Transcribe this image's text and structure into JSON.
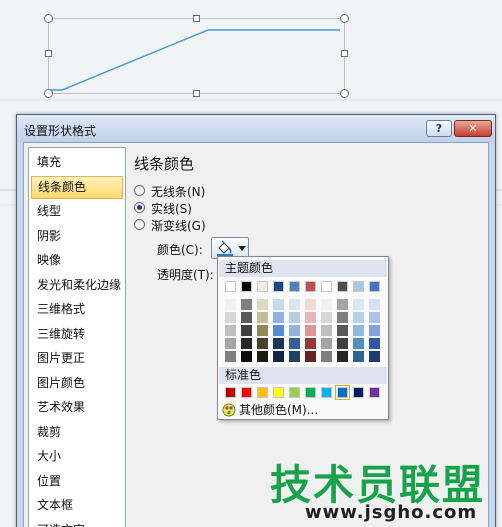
{
  "dialog": {
    "title": "设置形状格式",
    "help_label": "?",
    "close_label": "✕"
  },
  "nav": {
    "items": [
      {
        "label": "填充"
      },
      {
        "label": "线条颜色"
      },
      {
        "label": "线型"
      },
      {
        "label": "阴影"
      },
      {
        "label": "映像"
      },
      {
        "label": "发光和柔化边缘"
      },
      {
        "label": "三维格式"
      },
      {
        "label": "三维旋转"
      },
      {
        "label": "图片更正"
      },
      {
        "label": "图片颜色"
      },
      {
        "label": "艺术效果"
      },
      {
        "label": "裁剪"
      },
      {
        "label": "大小"
      },
      {
        "label": "位置"
      },
      {
        "label": "文本框"
      },
      {
        "label": "可选文字"
      }
    ],
    "selected": "线条颜色"
  },
  "panel": {
    "title": "线条颜色",
    "options": [
      {
        "label": "无线条(N)",
        "checked": false
      },
      {
        "label": "实线(S)",
        "checked": true
      },
      {
        "label": "渐变线(G)",
        "checked": false
      }
    ],
    "color_label": "颜色(C):",
    "transparency_label": "透明度(T):"
  },
  "palette": {
    "theme_header": "主题颜色",
    "standard_header": "标准色",
    "more_colors": "其他颜色(M)...",
    "theme_top": [
      "#ffffff",
      "#000000",
      "#eeece1",
      "#1f497d",
      "#4f81bd",
      "#c0504d",
      "#ffffff",
      "#4f4f4f",
      "#a6c9e3",
      "#4472c4"
    ],
    "theme_shades": [
      [
        "#f2f2f2",
        "#7f7f7f",
        "#ddd9c3",
        "#c6d9f0",
        "#dbe5f1",
        "#f2dcdb",
        "#f2f2f2",
        "#a5a5a5",
        "#dae8f2",
        "#d6e0f2"
      ],
      [
        "#d8d8d8",
        "#595959",
        "#c4bd97",
        "#8db3e2",
        "#b8cce4",
        "#e5b9b7",
        "#d8d8d8",
        "#7f7f7f",
        "#b5d2e6",
        "#aec1e5"
      ],
      [
        "#bfbfbf",
        "#3f3f3f",
        "#938953",
        "#548dd4",
        "#95b3d7",
        "#d99694",
        "#bfbfbf",
        "#595959",
        "#8fbbd9",
        "#85a2d8"
      ],
      [
        "#a5a5a5",
        "#262626",
        "#494429",
        "#17365d",
        "#366092",
        "#953734",
        "#a5a5a5",
        "#3f3f3f",
        "#4f8fbe",
        "#2e56a3"
      ],
      [
        "#7f7f7f",
        "#0c0c0c",
        "#1d1b10",
        "#0f243e",
        "#244061",
        "#632423",
        "#7f7f7f",
        "#262626",
        "#2d6791",
        "#1f3a6e"
      ]
    ],
    "standard": [
      "#c00000",
      "#ff0000",
      "#ffc000",
      "#ffff00",
      "#92d050",
      "#00b050",
      "#00b0f0",
      "#0070c0",
      "#002060",
      "#7030a0"
    ],
    "standard_selected_index": 7
  },
  "watermark": {
    "brand": "技术员联盟",
    "url": "www.jsgho.com"
  }
}
